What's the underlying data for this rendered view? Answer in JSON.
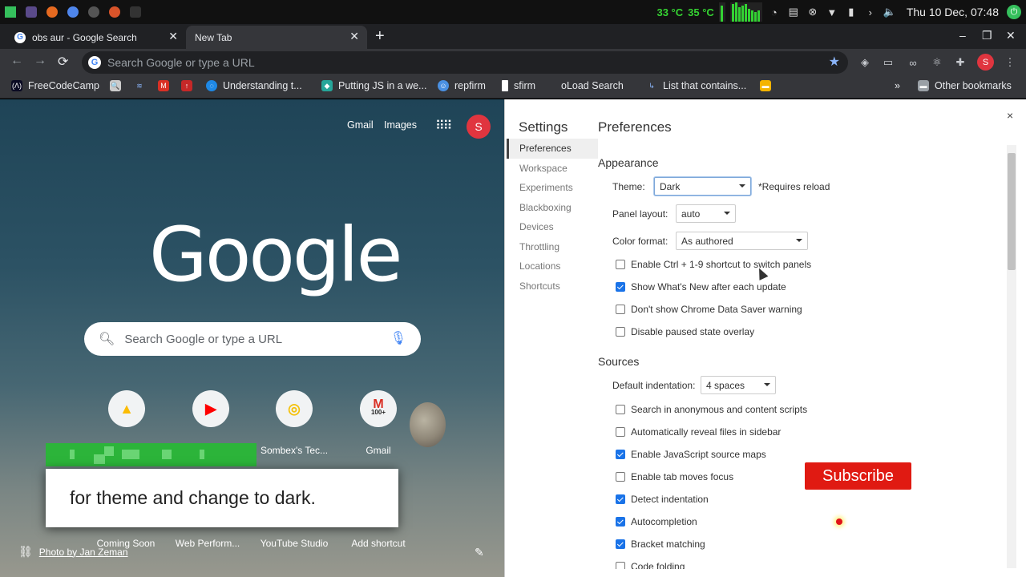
{
  "os_panel": {
    "temp1": "33 °C",
    "temp2": "35 °C",
    "clock": "Thu 10 Dec, 07:48"
  },
  "tabs": [
    {
      "title": "obs aur - Google Search",
      "close": "✕"
    },
    {
      "title": "New Tab",
      "close": "✕"
    }
  ],
  "new_tab_symbol": "+",
  "window_controls": {
    "minimize": "–",
    "restore": "❐",
    "close": "✕"
  },
  "toolbar": {
    "back": "←",
    "forward": "→",
    "reload": "⟳",
    "omnibox_placeholder": "Search Google or type a URL",
    "star": "★"
  },
  "bookmarks": {
    "items": [
      "FreeCodeCamp",
      "Understanding t...",
      "Putting JS in a we...",
      "repfirm",
      "sfirm",
      "oLoad Search",
      "List that contains..."
    ],
    "overflow": "»",
    "other": "Other bookmarks"
  },
  "ntp": {
    "gmail_link": "Gmail",
    "images_link": "Images",
    "logo": "Google",
    "search_placeholder": "Search Google or type a URL",
    "tiles_row1": [
      "Sombex's Tec...",
      "Gmail"
    ],
    "gmail_badge": "100+",
    "tiles_row2": [
      "Coming Soon",
      "Web Perform...",
      "YouTube Studio",
      "Add shortcut"
    ],
    "photo_credit": "Photo by Jan Zeman",
    "caption": "for theme and change to dark."
  },
  "devtools": {
    "title": "Settings",
    "close": "×",
    "nav": [
      "Preferences",
      "Workspace",
      "Experiments",
      "Blackboxing",
      "Devices",
      "Throttling",
      "Locations",
      "Shortcuts"
    ],
    "content_title": "Preferences",
    "appearance": {
      "heading": "Appearance",
      "theme_label": "Theme:",
      "theme_value": "Dark",
      "reload_note": "*Requires reload",
      "panel_layout_label": "Panel layout:",
      "panel_layout_value": "auto",
      "color_format_label": "Color format:",
      "color_format_value": "As authored",
      "checkboxes": [
        {
          "label": "Enable Ctrl + 1-9 shortcut to switch panels",
          "checked": false
        },
        {
          "label": "Show What's New after each update",
          "checked": true
        },
        {
          "label": "Don't show Chrome Data Saver warning",
          "checked": false
        },
        {
          "label": "Disable paused state overlay",
          "checked": false
        }
      ]
    },
    "sources": {
      "heading": "Sources",
      "indent_label": "Default indentation:",
      "indent_value": "4 spaces",
      "checkboxes": [
        {
          "label": "Search in anonymous and content scripts",
          "checked": false
        },
        {
          "label": "Automatically reveal files in sidebar",
          "checked": false
        },
        {
          "label": "Enable JavaScript source maps",
          "checked": true
        },
        {
          "label": "Enable tab moves focus",
          "checked": false
        },
        {
          "label": "Detect indentation",
          "checked": true
        },
        {
          "label": "Autocompletion",
          "checked": true
        },
        {
          "label": "Bracket matching",
          "checked": true
        },
        {
          "label": "Code folding",
          "checked": false
        }
      ]
    }
  },
  "subscribe": "Subscribe",
  "colors": {
    "accent_blue": "#1a73e8",
    "subscribe_red": "#e01a12",
    "green_monitor": "#33d233"
  }
}
